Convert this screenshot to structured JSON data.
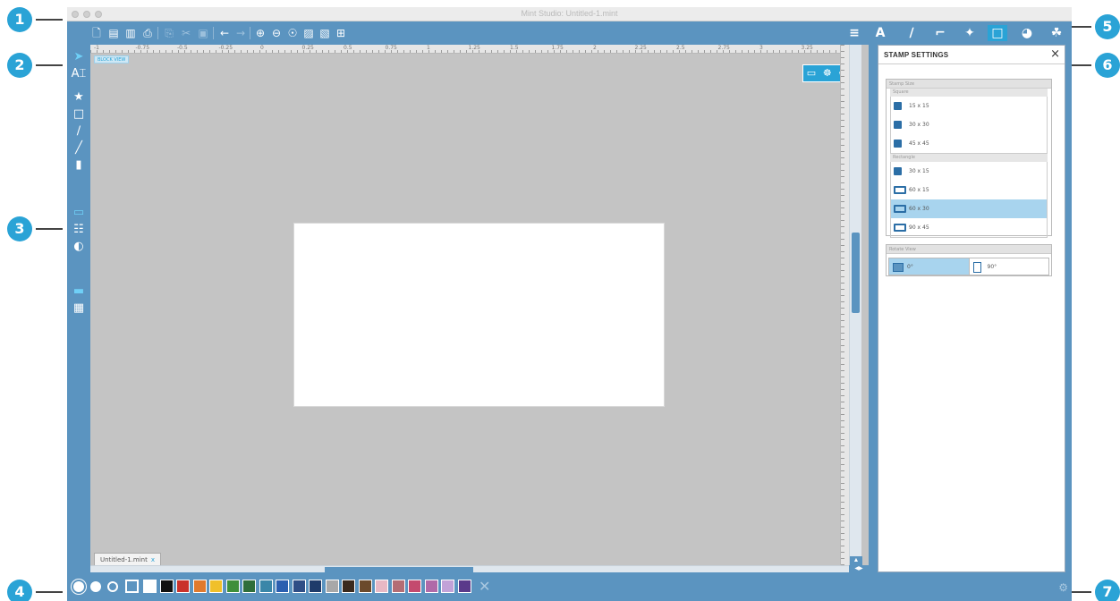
{
  "app": {
    "window_title": "Mint Studio: Untitled-1.mint",
    "document_tab": "Untitled-1.mint",
    "document_tab_close": "x",
    "view_badge": "BLOCK VIEW"
  },
  "callouts": [
    "1",
    "2",
    "3",
    "4",
    "5",
    "6",
    "7"
  ],
  "ruler_labels": [
    "-1",
    "-0.75",
    "-0.5",
    "-0.25",
    "0",
    "0.25",
    "0.5",
    "0.75",
    "1",
    "1.25",
    "1.5",
    "1.75",
    "2",
    "2.25",
    "2.5",
    "2.75",
    "3",
    "3.25"
  ],
  "toolbar": {
    "left_icons": [
      "new-icon",
      "open-icon",
      "open-recent-icon",
      "print-icon",
      "copy-icon",
      "cut-icon",
      "paste-icon",
      "undo-icon",
      "redo-icon",
      "zoom-in-icon",
      "zoom-out-icon",
      "zoom-fit-icon",
      "zoom-selection-icon",
      "zoom-page-icon",
      "fit-to-window-icon"
    ],
    "right_icons": [
      "menu-icon",
      "text-icon",
      "draw-icon",
      "crop-icon",
      "trace-icon",
      "stamp-icon",
      "palette-icon",
      "leaf-icon"
    ],
    "active_right": "stamp-icon"
  },
  "left_tools": [
    "select-icon",
    "text-tool-icon",
    "shape-icon",
    "rectangle-icon",
    "line-icon",
    "pen-icon",
    "eraser-icon",
    "block-view-icon",
    "stamp-view-icon",
    "color-view-icon",
    "panel-icon",
    "layout-icon"
  ],
  "stamp_settings": {
    "title": "STAMP SETTINGS",
    "close": "×",
    "stamp_size_label": "Stamp Size",
    "square_label": "Square",
    "square_options": [
      "15 x 15",
      "30 x 30",
      "45 x 45"
    ],
    "rectangle_label": "Rectangle",
    "rectangle_options": [
      "30 x 15",
      "60 x 15",
      "60 x 30",
      "90 x 45"
    ],
    "selected_option": "60 x 30",
    "rotate_label": "Rotate View",
    "rotate_options": [
      "0°",
      "90°"
    ],
    "selected_rotation": "0°"
  },
  "palette": {
    "colors": [
      "#ffffff",
      "#111111",
      "#c9322b",
      "#e07a2e",
      "#f0c02a",
      "#3f8f3a",
      "#2f6e3a",
      "#3a86a8",
      "#2b5fb0",
      "#2f4e86",
      "#1f3b6a",
      "#a8a8a8",
      "#3a2a1e",
      "#6b4a2c",
      "#e8b8c4",
      "#b46d74",
      "#c44a6e",
      "#b06aa8",
      "#c2a2d8",
      "#5a3a8a"
    ]
  }
}
